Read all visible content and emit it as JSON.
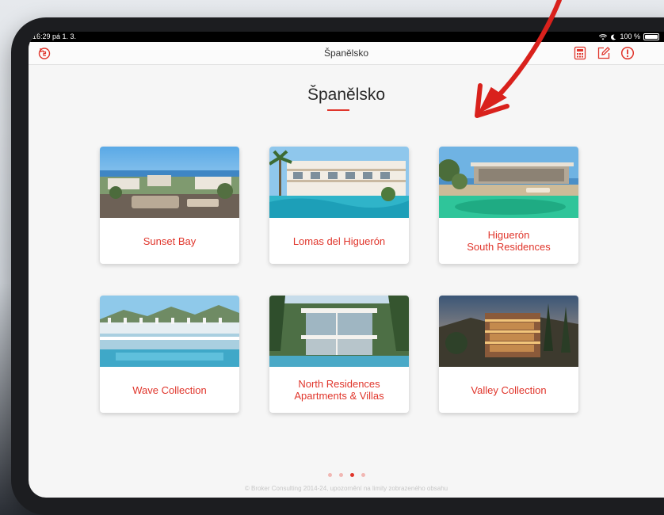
{
  "status_bar": {
    "time": "16:29  pá 1. 3.",
    "battery": "100 %"
  },
  "nav_bar": {
    "title": "Španělsko",
    "icons": [
      "rotate-back-icon",
      "calculator-icon",
      "edit-icon",
      "alert-icon"
    ]
  },
  "page": {
    "title": "Španělsko"
  },
  "projects": [
    {
      "label": "Sunset Bay"
    },
    {
      "label": "Lomas del Higuerón"
    },
    {
      "label": "Higuerón\nSouth Residences"
    },
    {
      "label": "Wave Collection"
    },
    {
      "label": "North Residences\nApartments & Villas"
    },
    {
      "label": "Valley Collection"
    }
  ],
  "pagination": {
    "total": 4,
    "current": 3
  },
  "footer": {
    "text": "© Broker Consulting 2014-24, upozornění na limity zobrazeného obsahu"
  },
  "colors": {
    "accent": "#e0352b",
    "screen_background": "#f6f6f6"
  }
}
